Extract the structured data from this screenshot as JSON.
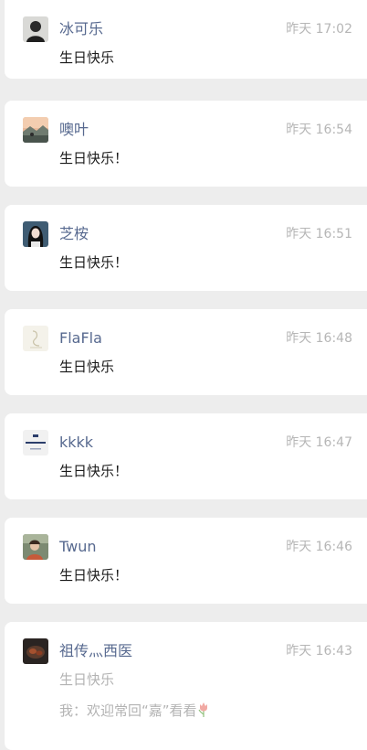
{
  "comments": [
    {
      "name": "冰可乐",
      "time": "昨天 17:02",
      "text": "生日快乐",
      "avatar": "person-dark-avatar"
    },
    {
      "name": "噢叶",
      "time": "昨天 16:54",
      "text": "生日快乐！",
      "avatar": "sunset-landscape-avatar"
    },
    {
      "name": "芝桉",
      "time": "昨天 16:51",
      "text": "生日快乐！",
      "avatar": "girl-portrait-avatar"
    },
    {
      "name": "FlaFla",
      "time": "昨天 16:48",
      "text": "生日快乐",
      "avatar": "sketch-avatar"
    },
    {
      "name": "kkkk",
      "time": "昨天 16:47",
      "text": "生日快乐！",
      "avatar": "thompson-logo-avatar"
    },
    {
      "name": "Twun",
      "time": "昨天 16:46",
      "text": "生日快乐！",
      "avatar": "selfie-avatar"
    },
    {
      "name": "祖传灬西医",
      "time": "昨天 16:43",
      "text": "生日快乐",
      "avatar": "food-plate-avatar",
      "reply": {
        "prefix": "我：",
        "text": "欢迎常回“嘉”看看",
        "emoji": "tulip-icon"
      }
    }
  ],
  "colors": {
    "background": "#ededed",
    "card": "#ffffff",
    "name": "#57698f",
    "time": "#b6b6b6",
    "message": "#1b1b1b",
    "muted": "#b3b3b3"
  }
}
